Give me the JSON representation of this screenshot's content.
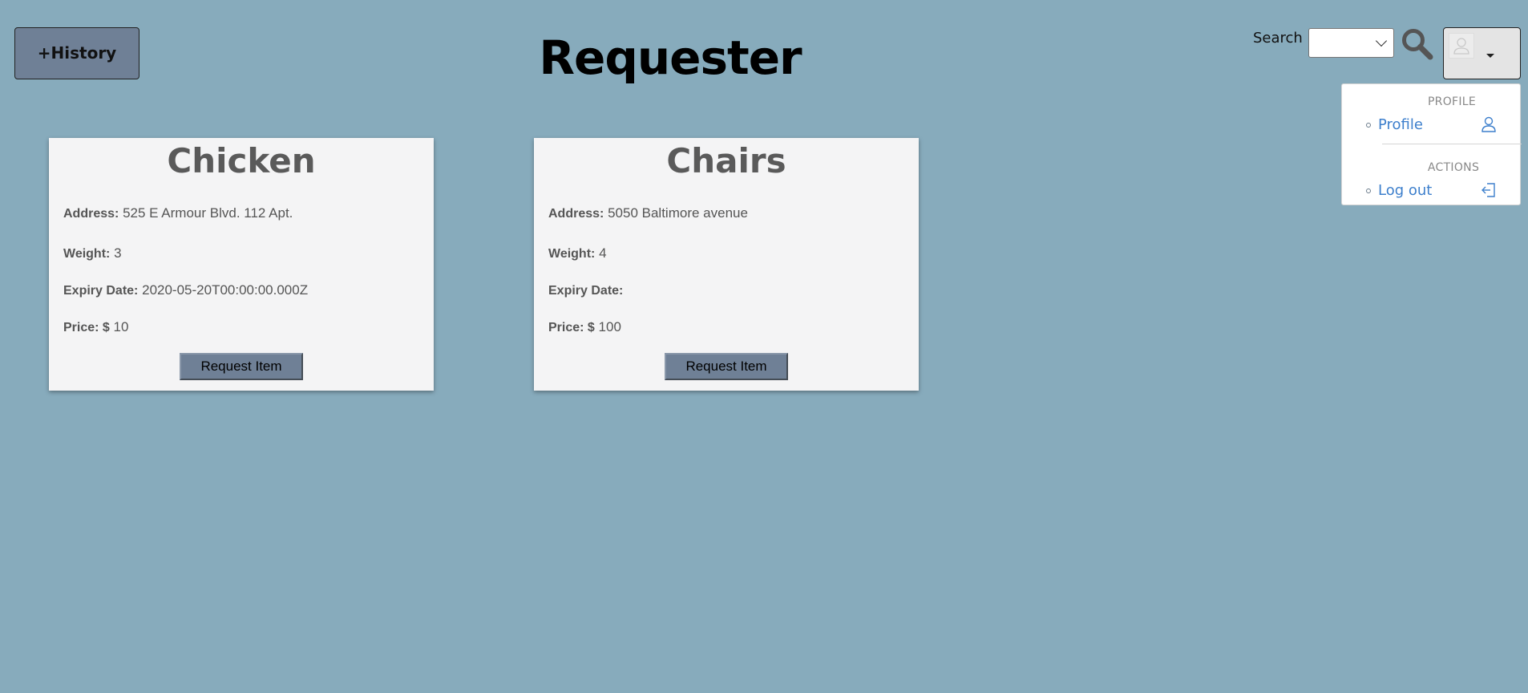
{
  "header": {
    "history_button": "+History",
    "title": "Requester",
    "search_label": "Search",
    "search_value": ""
  },
  "user_menu": {
    "profile_header": "PROFILE",
    "profile_item": "Profile",
    "actions_header": "ACTIONS",
    "logout_item": "Log out"
  },
  "cards": [
    {
      "title": "Chicken",
      "address_label": "Address:",
      "address": "525 E Armour Blvd. 112 Apt.",
      "weight_label": "Weight:",
      "weight": "3",
      "expiry_label": "Expiry Date:",
      "expiry": "2020-05-20T00:00:00.000Z",
      "price_label": "Price: $",
      "price": "10",
      "button": "Request Item"
    },
    {
      "title": "Chairs",
      "address_label": "Address:",
      "address": "5050 Baltimore avenue",
      "weight_label": "Weight:",
      "weight": "4",
      "expiry_label": "Expiry Date:",
      "expiry": "",
      "price_label": "Price: $",
      "price": "100",
      "button": "Request Item"
    }
  ],
  "colors": {
    "background": "#87abbc",
    "button": "#6f8096",
    "card": "#f4f4f5",
    "link": "#3d7fcc"
  },
  "icons": {
    "search": "magnifier",
    "avatar": "user-silhouette",
    "profile": "user-outline",
    "logout": "sign-out-arrow"
  }
}
